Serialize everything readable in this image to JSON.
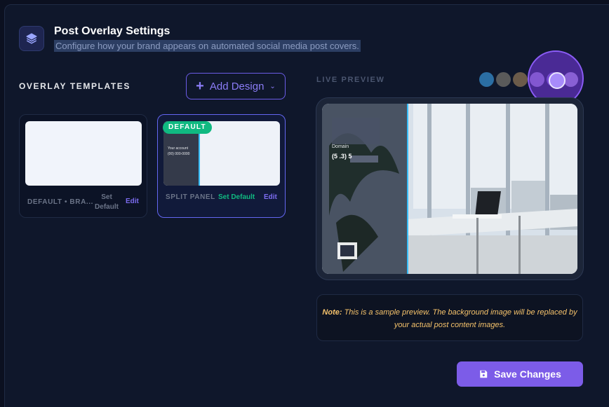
{
  "header": {
    "title": "Post Overlay Settings",
    "subtitle": "Configure how your brand appears on automated social media post covers."
  },
  "templates": {
    "section_label": "OVERLAY TEMPLATES",
    "add_button_label": "Add Design",
    "cards": [
      {
        "name": "DEFAULT • BRA...",
        "set_default_label_1": "Set",
        "set_default_label_2": "Default",
        "edit_label": "Edit"
      },
      {
        "name": "SPLIT PANEL",
        "badge": "DEFAULT",
        "set_default_label": "Set Default",
        "edit_label": "Edit",
        "thumb_text_1": "Your account",
        "thumb_text_2": "(00) 000-0000"
      }
    ]
  },
  "preview": {
    "section_label": "LIVE PREVIEW",
    "overlay_text_1": "Domain",
    "overlay_text_2": "(5 .3) 5",
    "avatar_colors": [
      "#2b6ea3",
      "#5a5a5a",
      "#6b5b4a",
      "#8b7bb0",
      "#6d5bb0",
      "#9a8fb5"
    ]
  },
  "note": {
    "prefix": "Note:",
    "text": "This is a sample preview. The background image will be replaced by your actual post content images."
  },
  "actions": {
    "save_label": "Save Changes"
  },
  "colors": {
    "accent": "#7c5ce8",
    "success": "#10b981",
    "warning": "#f5c26b"
  }
}
